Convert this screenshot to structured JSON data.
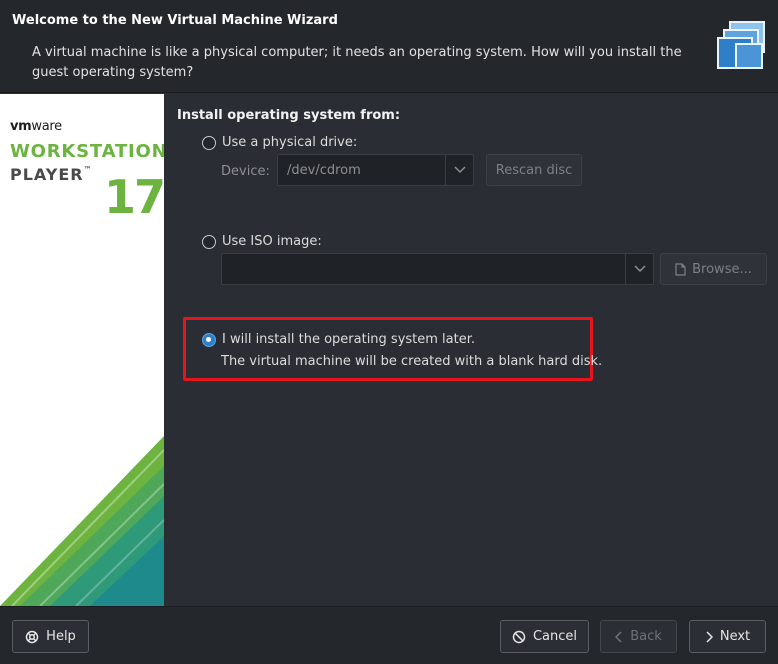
{
  "header": {
    "title": "Welcome to the New Virtual Machine Wizard",
    "description": "A virtual machine is like a physical computer; it needs an operating system. How will you install the guest operating system?",
    "icon": "virtual-machines-icon"
  },
  "sidebar": {
    "brand_bold": "vm",
    "brand_thin": "ware",
    "product_line1": "WORKSTATION",
    "product_line2": "PLAYER",
    "product_tm": "™",
    "version": "17",
    "accent_color": "#6cb33f"
  },
  "install": {
    "section_title": "Install operating system from:",
    "physical_drive": {
      "label": "Use a physical drive:",
      "selected": false,
      "device_label": "Device:",
      "device_value": "/dev/cdrom",
      "rescan_label": "Rescan disc"
    },
    "iso": {
      "label": "Use ISO image:",
      "selected": false,
      "path_value": "",
      "browse_label": "Browse..."
    },
    "later": {
      "label": "I will install the operating system later.",
      "sublabel": "The virtual machine will be created with a blank hard disk.",
      "selected": true,
      "highlight_color": "#e8141c"
    }
  },
  "footer": {
    "help_label": "Help",
    "cancel_label": "Cancel",
    "back_label": "Back",
    "next_label": "Next"
  }
}
